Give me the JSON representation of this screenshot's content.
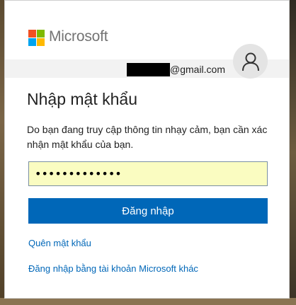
{
  "brand": {
    "name": "Microsoft"
  },
  "account": {
    "email_suffix": "@gmail.com",
    "avatar_icon": "user-icon"
  },
  "page": {
    "title": "Nhập mật khẩu",
    "description": "Do bạn đang truy cập thông tin nhạy cảm, bạn cần xác nhận mật khẩu của bạn."
  },
  "password_field": {
    "value": "•••••••••••••",
    "masked": true
  },
  "buttons": {
    "sign_in": "Đăng nhập"
  },
  "links": {
    "forgot_password": "Quên mật khẩu",
    "other_account": "Đăng nhập bằng tài khoản Microsoft khác"
  },
  "colors": {
    "accent": "#0067b8",
    "logo_red": "#f25022",
    "logo_green": "#7fba00",
    "logo_blue": "#00a4ef",
    "logo_yellow": "#ffb900",
    "input_autofill": "#fafcc1"
  }
}
